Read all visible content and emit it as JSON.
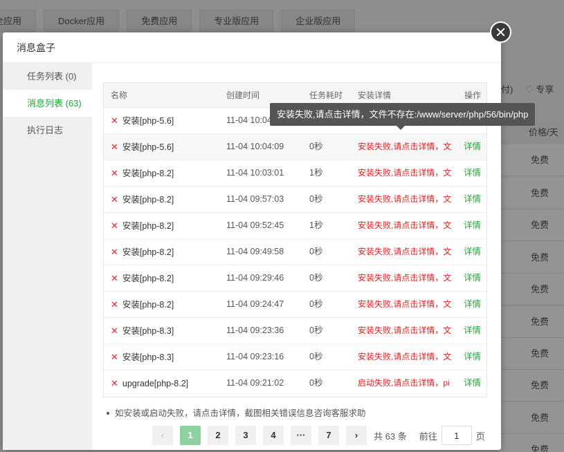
{
  "background": {
    "tabs": [
      "全应用",
      "Docker应用",
      "免费应用",
      "专业版应用",
      "企业版应用"
    ],
    "right_header": "付)",
    "right_share": "专享",
    "price_header": "价格/天",
    "free_label": "免费"
  },
  "modal": {
    "title": "消息盒子",
    "sidebar": [
      {
        "label": "任务列表 (0)",
        "active": false
      },
      {
        "label": "消息列表 (63)",
        "active": true
      },
      {
        "label": "执行日志",
        "active": false
      }
    ],
    "table": {
      "headers": [
        "名称",
        "创建时间",
        "任务耗时",
        "安装详情",
        "操作"
      ],
      "rows": [
        {
          "name": "安装[php-5.6]",
          "time": "11-04 10:04:09",
          "duration": "",
          "detail": "",
          "action": ""
        },
        {
          "name": "安装[php-5.6]",
          "time": "11-04 10:04:09",
          "duration": "0秒",
          "detail": "安装失败,请点击详情，文",
          "action": "详情"
        },
        {
          "name": "安装[php-8.2]",
          "time": "11-04 10:03:01",
          "duration": "1秒",
          "detail": "安装失败,请点击详情，文",
          "action": "详情"
        },
        {
          "name": "安装[php-8.2]",
          "time": "11-04 09:57:03",
          "duration": "0秒",
          "detail": "安装失败,请点击详情，文",
          "action": "详情"
        },
        {
          "name": "安装[php-8.2]",
          "time": "11-04 09:52:45",
          "duration": "1秒",
          "detail": "安装失败,请点击详情，文",
          "action": "详情"
        },
        {
          "name": "安装[php-8.2]",
          "time": "11-04 09:49:58",
          "duration": "0秒",
          "detail": "安装失败,请点击详情，文",
          "action": "详情"
        },
        {
          "name": "安装[php-8.2]",
          "time": "11-04 09:29:46",
          "duration": "0秒",
          "detail": "安装失败,请点击详情，文",
          "action": "详情"
        },
        {
          "name": "安装[php-8.2]",
          "time": "11-04 09:24:47",
          "duration": "0秒",
          "detail": "安装失败,请点击详情，文",
          "action": "详情"
        },
        {
          "name": "安装[php-8.3]",
          "time": "11-04 09:23:36",
          "duration": "0秒",
          "detail": "安装失败,请点击详情，文",
          "action": "详情"
        },
        {
          "name": "安装[php-8.3]",
          "time": "11-04 09:23:16",
          "duration": "0秒",
          "detail": "安装失败,请点击详情，文",
          "action": "详情"
        },
        {
          "name": "upgrade[php-8.2]",
          "time": "11-04 09:21:02",
          "duration": "0秒",
          "detail": "启动失败,请点击详情，pi",
          "action": "详情"
        }
      ]
    },
    "tooltip": "安装失败,请点击详情，文件不存在:/www/server/php/56/bin/php",
    "note": "如安装或启动失败，请点击详情，截图相关错误信息咨询客服求助",
    "pager": {
      "prev": "‹",
      "pages": [
        "1",
        "2",
        "3",
        "4",
        "···",
        "7"
      ],
      "next": "›",
      "total": "共 63 条",
      "goto_label": "前往",
      "goto_value": "1",
      "page_unit": "页"
    }
  },
  "colors": {
    "accent": "#20a53a",
    "error": "#e02020"
  }
}
